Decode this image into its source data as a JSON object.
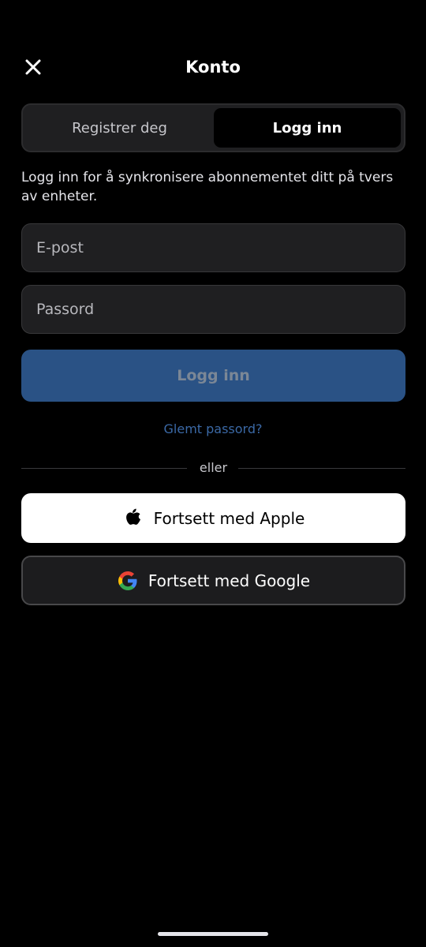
{
  "header": {
    "title": "Konto"
  },
  "tabs": [
    {
      "label": "Registrer deg",
      "selected": false
    },
    {
      "label": "Logg inn",
      "selected": true
    }
  ],
  "intro_text": "Logg inn for å synkronisere abonnementet ditt på tvers av enheter.",
  "form": {
    "email_placeholder": "E-post",
    "password_placeholder": "Passord",
    "submit_label": "Logg inn"
  },
  "forgot_password": "Glemt passord?",
  "divider_text": "eller",
  "social": {
    "apple_label": "Fortsett med Apple",
    "google_label": "Fortsett med Google"
  },
  "icons": [
    "close-icon",
    "apple-icon",
    "google-icon"
  ],
  "colors": {
    "background": "#000000",
    "primary_button": "#2a5285",
    "link": "#3b69a6"
  }
}
